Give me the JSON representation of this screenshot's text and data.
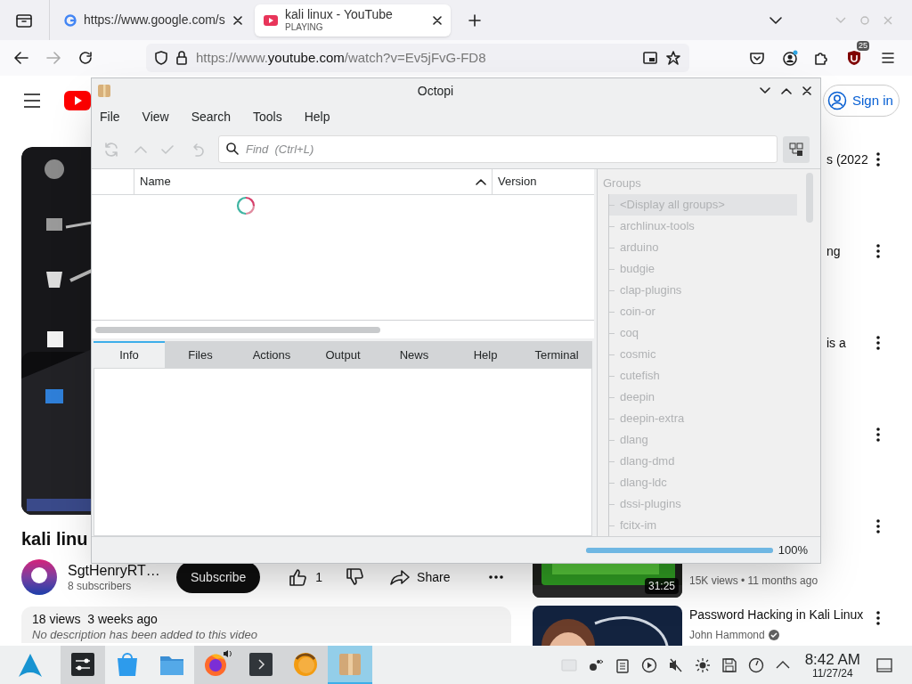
{
  "browser": {
    "tabs": [
      {
        "kind": "site",
        "title": "https://www.google.com/s",
        "selected": false
      },
      {
        "kind": "media",
        "title": "kali linux - YouTube",
        "subtitle": "PLAYING",
        "selected": true
      }
    ],
    "address": {
      "prefix": "https://www.",
      "domain": "youtube.com",
      "path": "/watch?v=Ev5jFvG-FD8"
    },
    "extension_badge": "25"
  },
  "youtube": {
    "sign_in": "Sign in",
    "video_title": "kali linu",
    "channel": {
      "name": "SgtHenryRT…",
      "subscribers": "8 subscribers"
    },
    "subscribe": "Subscribe",
    "likes": "1",
    "share": "Share",
    "description": {
      "stats": "18 views  3 weeks ago",
      "text": "No description has been added to this video"
    },
    "recommendations": [
      {
        "kind": "covered",
        "title": "s (2022"
      },
      {
        "kind": "covered",
        "title": "ng"
      },
      {
        "kind": "covered",
        "title": "is a"
      },
      {
        "kind": "covered"
      },
      {
        "kind": "card",
        "duration": "31:25",
        "meta": "15K views • 11 months ago"
      },
      {
        "kind": "card",
        "title": "Password Hacking in Kali Linux",
        "channel": "John Hammond"
      }
    ]
  },
  "octopi": {
    "title": "Octopi",
    "menu": [
      "File",
      "View",
      "Search",
      "Tools",
      "Help"
    ],
    "search": {
      "placeholder": "Find  (Ctrl+L)"
    },
    "columns": [
      "Name",
      "Version"
    ],
    "tabs": [
      {
        "label": "Info",
        "selected": true
      },
      {
        "label": "Files",
        "selected": false
      },
      {
        "label": "Actions",
        "selected": false
      },
      {
        "label": "Output",
        "selected": false
      },
      {
        "label": "News",
        "selected": false
      },
      {
        "label": "Help",
        "selected": false
      },
      {
        "label": "Terminal",
        "selected": false
      }
    ],
    "groups_header": "Groups",
    "groups": [
      {
        "label": "<Display all groups>",
        "selected": true
      },
      {
        "label": "archlinux-tools",
        "selected": false
      },
      {
        "label": "arduino",
        "selected": false
      },
      {
        "label": "budgie",
        "selected": false
      },
      {
        "label": "clap-plugins",
        "selected": false
      },
      {
        "label": "coin-or",
        "selected": false
      },
      {
        "label": "coq",
        "selected": false
      },
      {
        "label": "cosmic",
        "selected": false
      },
      {
        "label": "cutefish",
        "selected": false
      },
      {
        "label": "deepin",
        "selected": false
      },
      {
        "label": "deepin-extra",
        "selected": false
      },
      {
        "label": "dlang",
        "selected": false
      },
      {
        "label": "dlang-dmd",
        "selected": false
      },
      {
        "label": "dlang-ldc",
        "selected": false
      },
      {
        "label": "dssi-plugins",
        "selected": false
      },
      {
        "label": "fcitx-im",
        "selected": false
      }
    ],
    "progress": {
      "level": 1,
      "reading": "100%"
    }
  },
  "taskbar": {
    "apps": [
      {
        "kind": "mixer",
        "open": true,
        "selected": false,
        "audio": false
      },
      {
        "kind": "store",
        "open": false,
        "selected": false,
        "audio": false
      },
      {
        "kind": "files",
        "open": false,
        "selected": false,
        "audio": false
      },
      {
        "kind": "firefox",
        "open": true,
        "selected": false,
        "audio": true
      },
      {
        "kind": "terminal",
        "open": true,
        "selected": false,
        "audio": false
      },
      {
        "kind": "updater",
        "open": true,
        "selected": false,
        "audio": false
      },
      {
        "kind": "package",
        "open": true,
        "selected": true,
        "audio": false
      }
    ],
    "time": "8:42 AM",
    "date": "11/27/24"
  }
}
